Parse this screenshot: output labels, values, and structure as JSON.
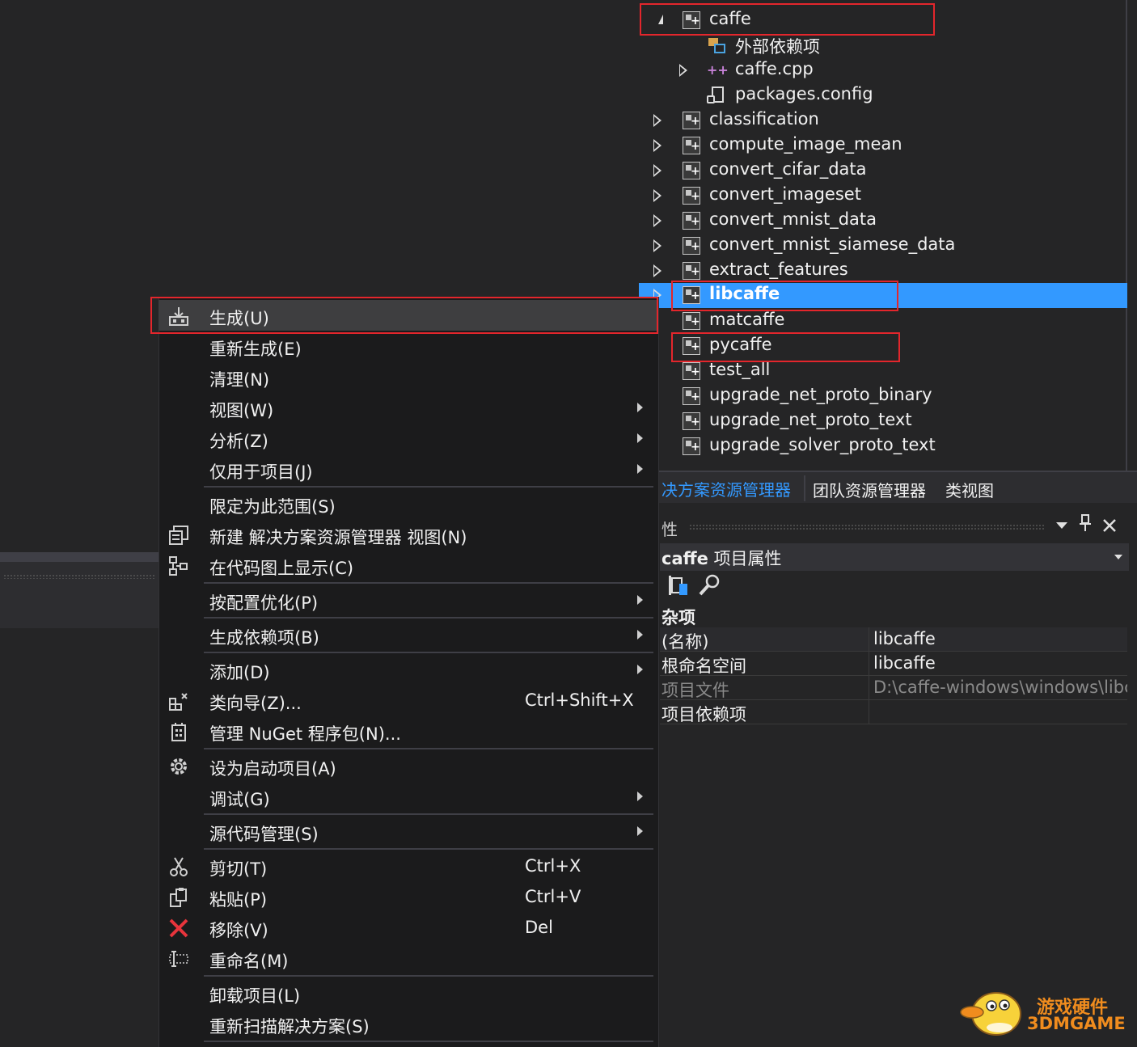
{
  "tree": {
    "root": "caffe",
    "children": [
      "外部依赖项",
      "caffe.cpp",
      "packages.config"
    ],
    "projects": [
      "classification",
      "compute_image_mean",
      "convert_cifar_data",
      "convert_imageset",
      "convert_mnist_data",
      "convert_mnist_siamese_data",
      "extract_features",
      "libcaffe",
      "matcaffe",
      "pycaffe",
      "test_all",
      "upgrade_net_proto_binary",
      "upgrade_net_proto_text",
      "upgrade_solver_proto_text"
    ],
    "selected": "libcaffe"
  },
  "tabs": {
    "solution_explorer": "决方案资源管理器",
    "team_explorer": "团队资源管理器",
    "class_view": "类视图"
  },
  "properties": {
    "title": "性",
    "object": "caffe",
    "object_suffix": "项目属性",
    "category": "杂项",
    "rows": [
      {
        "key": "(名称)",
        "value": "libcaffe"
      },
      {
        "key": "根命名空间",
        "value": "libcaffe"
      },
      {
        "key": "项目文件",
        "value": "D:\\caffe-windows\\windows\\libc"
      },
      {
        "key": "项目依赖项",
        "value": ""
      }
    ]
  },
  "menu": {
    "build": "生成(U)",
    "rebuild": "重新生成(E)",
    "clean": "清理(N)",
    "view": "视图(W)",
    "analyze": "分析(Z)",
    "project_only": "仅用于项目(J)",
    "scope": "限定为此范围(S)",
    "new_view": "新建 解决方案资源管理器 视图(N)",
    "code_map": "在代码图上显示(C)",
    "pgo": "按配置优化(P)",
    "build_deps": "生成依赖项(B)",
    "add": "添加(D)",
    "class_wizard": "类向导(Z)...",
    "class_wizard_sc": "Ctrl+Shift+X",
    "nuget": "管理 NuGet 程序包(N)...",
    "startup": "设为启动项目(A)",
    "debug": "调试(G)",
    "source_control": "源代码管理(S)",
    "cut": "剪切(T)",
    "cut_sc": "Ctrl+X",
    "paste": "粘贴(P)",
    "paste_sc": "Ctrl+V",
    "remove": "移除(V)",
    "remove_sc": "Del",
    "rename": "重命名(M)",
    "unload": "卸载项目(L)",
    "rescan": "重新扫描解决方案(S)"
  },
  "watermark": {
    "line1": "游戏硬件",
    "line2": "3DMGAME"
  }
}
